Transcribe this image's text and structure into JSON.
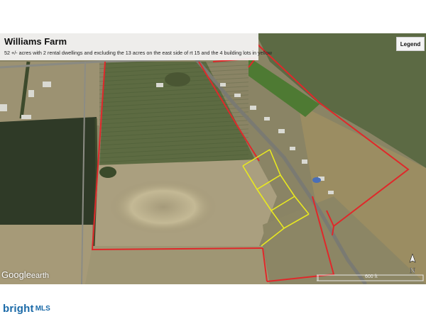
{
  "header": {
    "title": "Williams Farm",
    "subtitle": "52 +/- acres with 2 rental dwellings and excluding the 13 acres on the east side of rt 15 and the 4 building lots in yellow"
  },
  "legend_button": {
    "label": "Legend"
  },
  "map": {
    "attribution_brand": "Google",
    "attribution_product": "earth",
    "scale_label": "600 ft",
    "north_label": "N",
    "property_outline_color": "#e0282a",
    "excluded_lots_color": "#e8e820"
  },
  "footer": {
    "logo_text": "bright",
    "logo_suffix": "MLS",
    "brand_color": "#1b6aa8"
  }
}
